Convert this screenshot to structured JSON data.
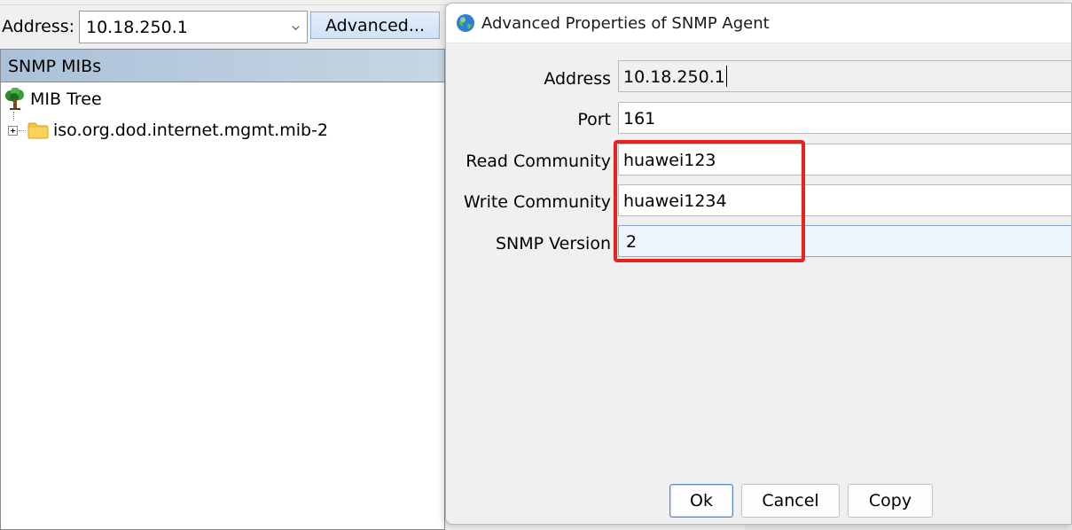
{
  "main_window": {
    "address_label": "Address:",
    "address_value": "10.18.250.1",
    "advanced_button": "Advanced...",
    "mib_panel_title": "SNMP MIBs",
    "tree": {
      "root_label": "MIB Tree",
      "child_label": "iso.org.dod.internet.mgmt.mib-2"
    }
  },
  "dialog": {
    "title": "Advanced Properties of SNMP Agent",
    "title_icon": "globe-icon",
    "fields": {
      "address": {
        "label": "Address",
        "value": "10.18.250.1"
      },
      "port": {
        "label": "Port",
        "value": "161"
      },
      "read_community": {
        "label": "Read Community",
        "value": "huawei123"
      },
      "write_community": {
        "label": "Write Community",
        "value": "huawei1234"
      },
      "snmp_version": {
        "label": "SNMP Version",
        "value": "2"
      }
    },
    "buttons": {
      "ok": "Ok",
      "cancel": "Cancel",
      "copy": "Copy"
    },
    "highlight_color": "#e8221c"
  },
  "icons": {
    "tree_root": "tree-icon",
    "folder": "folder-icon",
    "expander": "plus-expander-icon",
    "combo_arrow": "chevron-down-icon"
  }
}
